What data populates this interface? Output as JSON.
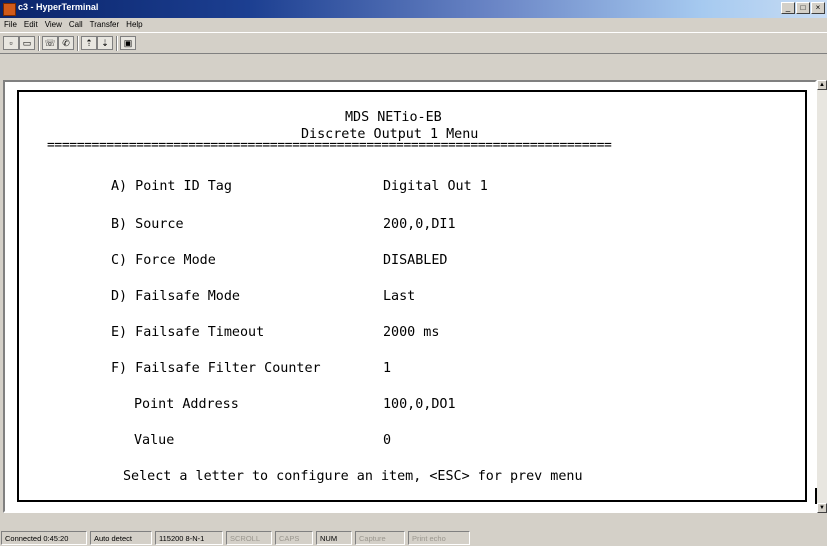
{
  "window": {
    "title": "c3 - HyperTerminal",
    "buttons": [
      "_",
      "□",
      "×"
    ]
  },
  "menu": [
    "File",
    "Edit",
    "View",
    "Call",
    "Transfer",
    "Help"
  ],
  "toolbar_icons": [
    "new-icon",
    "open-icon",
    "disconnect-icon",
    "dial-icon",
    "send-icon",
    "receive-icon",
    "properties-icon"
  ],
  "terminal": {
    "header_line1": "MDS NETio-EB",
    "header_line2": "Discrete Output 1 Menu",
    "separator": "============================================================================",
    "items": [
      {
        "label": "A) Point ID Tag",
        "value": "Digital Out 1"
      },
      {
        "label": "B) Source",
        "value": "200,0,DI1"
      },
      {
        "label": "C) Force Mode",
        "value": "DISABLED"
      },
      {
        "label": "D) Failsafe Mode",
        "value": "Last"
      },
      {
        "label": "E) Failsafe Timeout",
        "value": "2000 ms"
      },
      {
        "label": "F) Failsafe Filter Counter",
        "value": "1"
      },
      {
        "label": "Point Address",
        "value": "100,0,DO1"
      },
      {
        "label": "Value",
        "value": "0"
      }
    ],
    "prompt": "Select a letter to configure an item, <ESC> for prev menu"
  },
  "status_bar": {
    "connected": "Connected 0:45:20",
    "detect": "Auto detect",
    "settings": "115200 8-N-1",
    "scroll": "SCROLL",
    "caps": "CAPS",
    "num": "NUM",
    "capture": "Capture",
    "print_echo": "Print echo"
  }
}
